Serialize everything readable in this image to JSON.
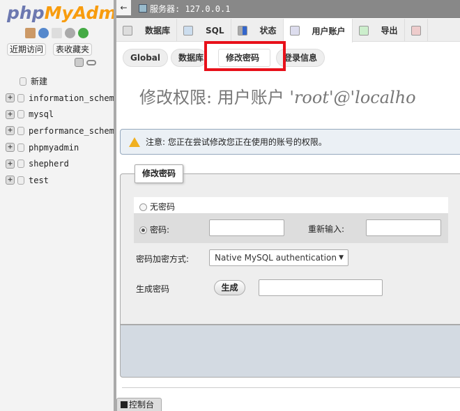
{
  "sidebar": {
    "logo": {
      "php": "php",
      "myadmin": "MyAdmin"
    },
    "recent_label": "近期访问",
    "favorites_label": "表收藏夹",
    "new_label": "新建",
    "databases": [
      "information_schema",
      "mysql",
      "performance_schema",
      "phpmyadmin",
      "shepherd",
      "test"
    ]
  },
  "topbar": {
    "server": "服务器: 127.0.0.1"
  },
  "tabs": [
    {
      "label": "数据库",
      "icon": "database-icon"
    },
    {
      "label": "SQL",
      "icon": "sql-icon"
    },
    {
      "label": "状态",
      "icon": "status-chart-icon"
    },
    {
      "label": "用户账户",
      "icon": "user-card-icon",
      "active": true
    },
    {
      "label": "导出",
      "icon": "export-icon"
    },
    {
      "label": "",
      "icon": "import-icon"
    }
  ],
  "subtabs": [
    {
      "label": "Global"
    },
    {
      "label": "数据库"
    },
    {
      "label": "修改密码",
      "active": true
    },
    {
      "label": "登录信息"
    }
  ],
  "heading": {
    "prefix": "修改权限:  用户账户 ",
    "user": "'root'@'localho"
  },
  "notice": "注意: 您正在尝试修改您正在使用的账号的权限。",
  "form": {
    "legend": "修改密码",
    "no_password": "无密码",
    "password": "密码:",
    "password_value": "",
    "reenter": "重新输入:",
    "reenter_value": "",
    "hashing_label": "密码加密方式:",
    "hashing_value": "Native MySQL authentication",
    "generate_label": "生成密码",
    "generate_button": "生成",
    "generated_value": ""
  },
  "console": "控制台",
  "colors": {
    "highlight": "#e8101a",
    "logo_php": "#6c78b0",
    "logo_myadmin": "#f89c0e"
  }
}
